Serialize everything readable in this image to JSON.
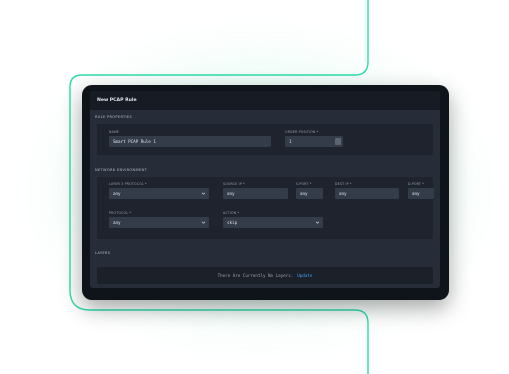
{
  "window": {
    "title": "New PCAP Rule"
  },
  "rule_properties": {
    "section_label": "RULE PROPERTIES",
    "name_label": "NAME",
    "name_value": "Smart PCAP Rule 1",
    "order_label": "ORDER POSITION *",
    "order_value": "1"
  },
  "network_environment": {
    "section_label": "NETWORK ENVIRONMENT",
    "layer3_label": "LAYER 3 PROTOCOL *",
    "layer3_value": "any",
    "source_ip_label": "SOURCE IP *",
    "source_ip_value": "any",
    "s_port_label": "S.PORT *",
    "s_port_value": "any",
    "dest_ip_label": "DEST IP *",
    "dest_ip_value": "any",
    "d_port_label": "D.PORT *",
    "d_port_value": "any",
    "protocol_label": "PROTOCOL *",
    "protocol_value": "any",
    "action_label": "ACTION *",
    "action_value": "skip"
  },
  "layers": {
    "section_label": "LAYERS",
    "empty_text": "There Are Currently No Layers.",
    "empty_link": "Update"
  },
  "colors": {
    "accent_line": "#2fdcaa",
    "link": "#3ea0ff"
  }
}
